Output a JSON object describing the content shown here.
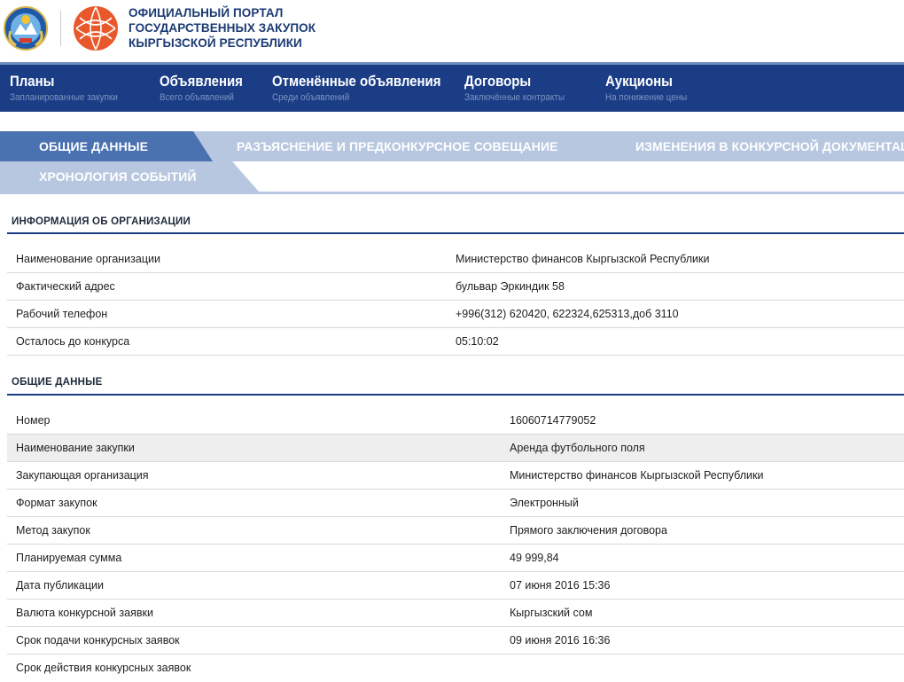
{
  "header": {
    "title_lines": [
      "ОФИЦИАЛЬНЫЙ ПОРТАЛ",
      "ГОСУДАРСТВЕННЫХ ЗАКУПОК",
      "КЫРГЫЗСКОЙ РЕСПУБЛИКИ"
    ]
  },
  "nav": [
    {
      "label": "Планы",
      "sub": "Запланированные закупки"
    },
    {
      "label": "Объявления",
      "sub": "Всего объявлений"
    },
    {
      "label": "Отменённые объявления",
      "sub": "Среди объявлений"
    },
    {
      "label": "Договоры",
      "sub": "Заключённые контракты"
    },
    {
      "label": "Аукционы",
      "sub": "На понижение цены"
    }
  ],
  "tabs": [
    "ОБЩИЕ ДАННЫЕ",
    "РАЗЪЯСНЕНИЕ И ПРЕДКОНКУРСНОЕ СОВЕЩАНИЕ",
    "ИЗМЕНЕНИЯ В КОНКУРСНОЙ ДОКУМЕНТАЦИИ",
    "ХРОНОЛОГИЯ СОБЫТИЙ"
  ],
  "org_section": {
    "title": "ИНФОРМАЦИЯ ОБ ОРГАНИЗАЦИИ",
    "rows": [
      {
        "label": "Наименование организации",
        "value": "Министерство финансов Кыргызской Республики"
      },
      {
        "label": "Фактический адрес",
        "value": "бульвар Эркиндик 58"
      },
      {
        "label": "Рабочий телефон",
        "value": "+996(312) 620420, 622324,625313,доб 3110"
      },
      {
        "label": "Осталось до конкурса",
        "value": "05:10:02"
      }
    ]
  },
  "general_section": {
    "title": "ОБЩИЕ ДАННЫЕ",
    "rows": [
      {
        "label": "Номер",
        "value": "16060714779052"
      },
      {
        "label": "Наименование закупки",
        "value": "Аренда футбольного поля"
      },
      {
        "label": "Закупающая организация",
        "value": "Министерство финансов Кыргызской Республики"
      },
      {
        "label": "Формат закупок",
        "value": "Электронный"
      },
      {
        "label": "Метод закупок",
        "value": "Прямого заключения договора"
      },
      {
        "label": "Планируемая сумма",
        "value": "49 999,84"
      },
      {
        "label": "Дата публикации",
        "value": "07 июня 2016 15:36"
      },
      {
        "label": "Валюта конкурсной заявки",
        "value": "Кыргызский сом"
      },
      {
        "label": "Срок подачи конкурсных заявок",
        "value": "09 июня 2016 16:36"
      },
      {
        "label": "Срок действия конкурсных заявок",
        "value": ""
      }
    ]
  },
  "colors": {
    "nav_bg": "#1a3d86",
    "tab_active": "#4a72b0",
    "tab_inactive": "#b8c7e0",
    "title_blue": "#1b3a73",
    "logo_orange": "#e8582a"
  }
}
